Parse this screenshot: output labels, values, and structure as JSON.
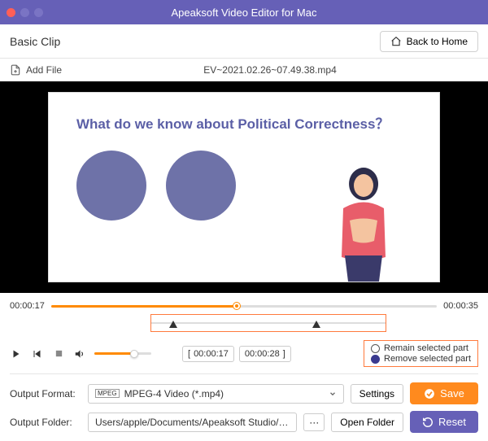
{
  "titlebar": {
    "title": "Apeaksoft Video Editor for Mac"
  },
  "header": {
    "section": "Basic Clip",
    "back": "Back to Home"
  },
  "filebar": {
    "add": "Add File",
    "filename": "EV~2021.02.26~07.49.38.mp4"
  },
  "slide": {
    "title": "What do we know about Political Correctness？"
  },
  "timeline": {
    "start": "00:00:17",
    "end": "00:00:35"
  },
  "clip": {
    "in": "00:00:17",
    "out": "00:00:28"
  },
  "options": {
    "remain": "Remain selected part",
    "remove": "Remove selected part"
  },
  "output": {
    "format_label": "Output Format:",
    "format_value": "MPEG-4 Video (*.mp4)",
    "settings": "Settings",
    "folder_label": "Output Folder:",
    "folder_value": "Users/apple/Documents/Apeaksoft Studio/Video",
    "open_folder": "Open Folder"
  },
  "actions": {
    "save": "Save",
    "reset": "Reset"
  },
  "colors": {
    "accent_orange": "#ff8a1e",
    "accent_purple": "#6660b7"
  }
}
